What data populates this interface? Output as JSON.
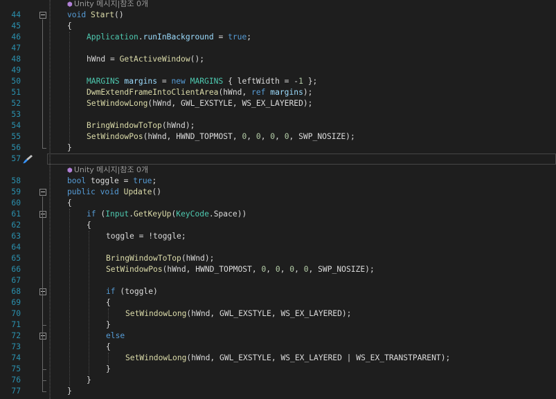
{
  "codelens_text": "Unity 메시지|참조 0개",
  "quick_action_icon": "brush-icon",
  "colors": {
    "background": "#1e1e1e",
    "keyword": "#569cd6",
    "type": "#4ec9b0",
    "method": "#dcdcaa",
    "number": "#b5cea8",
    "line_number": "#2b91af"
  },
  "lines": [
    {
      "n": "44",
      "fold": true,
      "lens": true,
      "t": [
        [
          "kw",
          "void "
        ],
        [
          "fn",
          "Start"
        ],
        [
          "",
          "()"
        ]
      ]
    },
    {
      "n": "45",
      "t": [
        [
          "",
          "{"
        ]
      ]
    },
    {
      "n": "46",
      "ind": 1,
      "t": [
        [
          "ty",
          "Application"
        ],
        [
          "",
          "."
        ],
        [
          "vr",
          "runInBackground"
        ],
        [
          "",
          " = "
        ],
        [
          "kw",
          "true"
        ],
        [
          "",
          ";"
        ]
      ]
    },
    {
      "n": "47",
      "t": []
    },
    {
      "n": "48",
      "ind": 1,
      "t": [
        [
          "",
          "hWnd = "
        ],
        [
          "fn",
          "GetActiveWindow"
        ],
        [
          "",
          "();"
        ]
      ]
    },
    {
      "n": "49",
      "t": []
    },
    {
      "n": "50",
      "ind": 1,
      "t": [
        [
          "ty",
          "MARGINS"
        ],
        [
          "",
          " "
        ],
        [
          "vr",
          "margins"
        ],
        [
          "",
          " = "
        ],
        [
          "kw",
          "new"
        ],
        [
          "",
          " "
        ],
        [
          "ty",
          "MARGINS"
        ],
        [
          "",
          " { leftWidth = -"
        ],
        [
          "nm",
          "1"
        ],
        [
          "",
          " };"
        ]
      ]
    },
    {
      "n": "51",
      "ind": 1,
      "t": [
        [
          "fn",
          "DwmExtendFrameIntoClientArea"
        ],
        [
          "",
          "(hWnd, "
        ],
        [
          "kw",
          "ref"
        ],
        [
          "",
          " "
        ],
        [
          "vr",
          "margins"
        ],
        [
          "",
          ");"
        ]
      ]
    },
    {
      "n": "52",
      "ind": 1,
      "t": [
        [
          "fn",
          "SetWindowLong"
        ],
        [
          "",
          "(hWnd, GWL_EXSTYLE, WS_EX_LAYERED);"
        ]
      ]
    },
    {
      "n": "53",
      "t": []
    },
    {
      "n": "54",
      "ind": 1,
      "t": [
        [
          "fn",
          "BringWindowToTop"
        ],
        [
          "",
          "(hWnd);"
        ]
      ]
    },
    {
      "n": "55",
      "ind": 1,
      "t": [
        [
          "fn",
          "SetWindowPos"
        ],
        [
          "",
          "(hWnd, HWND_TOPMOST, "
        ],
        [
          "nm",
          "0"
        ],
        [
          "",
          ", "
        ],
        [
          "nm",
          "0"
        ],
        [
          "",
          ", "
        ],
        [
          "nm",
          "0"
        ],
        [
          "",
          ", "
        ],
        [
          "nm",
          "0"
        ],
        [
          "",
          ", SWP_NOSIZE);"
        ]
      ]
    },
    {
      "n": "56",
      "t": [
        [
          "",
          "}"
        ]
      ]
    },
    {
      "n": "57",
      "t": []
    },
    {
      "n": "58",
      "lens": true,
      "t": [
        [
          "kw",
          "bool"
        ],
        [
          "",
          " toggle = "
        ],
        [
          "kw",
          "true"
        ],
        [
          "",
          ";"
        ]
      ]
    },
    {
      "n": "59",
      "fold": true,
      "t": [
        [
          "kw",
          "public"
        ],
        [
          "",
          " "
        ],
        [
          "kw",
          "void"
        ],
        [
          "",
          " "
        ],
        [
          "fn",
          "Update"
        ],
        [
          "",
          "()"
        ]
      ]
    },
    {
      "n": "60",
      "t": [
        [
          "",
          "{"
        ]
      ]
    },
    {
      "n": "61",
      "fold": true,
      "ind": 1,
      "t": [
        [
          "kw",
          "if"
        ],
        [
          "",
          " ("
        ],
        [
          "ty",
          "Input"
        ],
        [
          "",
          "."
        ],
        [
          "fn",
          "GetKeyUp"
        ],
        [
          "",
          "("
        ],
        [
          "ty",
          "KeyCode"
        ],
        [
          "",
          ".Space))"
        ]
      ]
    },
    {
      "n": "62",
      "ind": 1,
      "t": [
        [
          "",
          "{"
        ]
      ]
    },
    {
      "n": "63",
      "ind": 2,
      "t": [
        [
          "",
          "toggle = !toggle;"
        ]
      ]
    },
    {
      "n": "64",
      "t": []
    },
    {
      "n": "65",
      "ind": 2,
      "t": [
        [
          "fn",
          "BringWindowToTop"
        ],
        [
          "",
          "(hWnd);"
        ]
      ]
    },
    {
      "n": "66",
      "ind": 2,
      "t": [
        [
          "fn",
          "SetWindowPos"
        ],
        [
          "",
          "(hWnd, HWND_TOPMOST, "
        ],
        [
          "nm",
          "0"
        ],
        [
          "",
          ", "
        ],
        [
          "nm",
          "0"
        ],
        [
          "",
          ", "
        ],
        [
          "nm",
          "0"
        ],
        [
          "",
          ", "
        ],
        [
          "nm",
          "0"
        ],
        [
          "",
          ", SWP_NOSIZE);"
        ]
      ]
    },
    {
      "n": "67",
      "t": []
    },
    {
      "n": "68",
      "fold": true,
      "ind": 2,
      "t": [
        [
          "kw",
          "if"
        ],
        [
          "",
          " (toggle)"
        ]
      ]
    },
    {
      "n": "69",
      "ind": 2,
      "t": [
        [
          "",
          "{"
        ]
      ]
    },
    {
      "n": "70",
      "ind": 3,
      "t": [
        [
          "fn",
          "SetWindowLong"
        ],
        [
          "",
          "(hWnd, GWL_EXSTYLE, WS_EX_LAYERED);"
        ]
      ]
    },
    {
      "n": "71",
      "ind": 2,
      "t": [
        [
          "",
          "}"
        ]
      ]
    },
    {
      "n": "72",
      "fold": true,
      "ind": 2,
      "t": [
        [
          "kw",
          "else"
        ]
      ]
    },
    {
      "n": "73",
      "ind": 2,
      "t": [
        [
          "",
          "{"
        ]
      ]
    },
    {
      "n": "74",
      "ind": 3,
      "t": [
        [
          "fn",
          "SetWindowLong"
        ],
        [
          "",
          "(hWnd, GWL_EXSTYLE, WS_EX_LAYERED | WS_EX_TRANSTPARENT);"
        ]
      ]
    },
    {
      "n": "75",
      "ind": 2,
      "t": [
        [
          "",
          "}"
        ]
      ]
    },
    {
      "n": "76",
      "ind": 1,
      "t": [
        [
          "",
          "}"
        ]
      ]
    },
    {
      "n": "77",
      "t": [
        [
          "",
          "}"
        ]
      ]
    }
  ]
}
